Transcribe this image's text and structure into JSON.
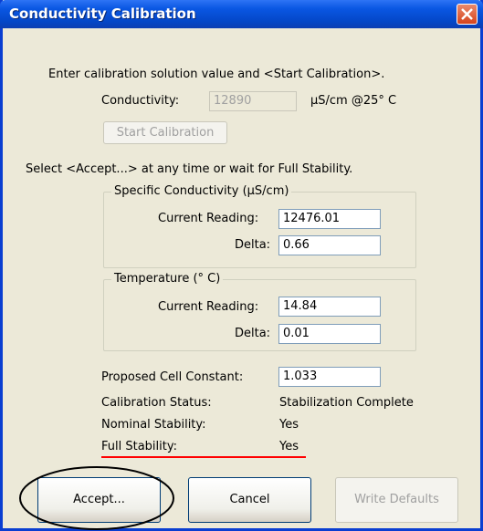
{
  "window": {
    "title": "Conductivity Calibration"
  },
  "instructions": {
    "line1": "Enter calibration solution value and <Start Calibration>.",
    "line2": "Select <Accept...> at any time or wait for Full Stability."
  },
  "conductivity": {
    "label": "Conductivity:",
    "value": "12890",
    "unit": "µS/cm @25° C"
  },
  "start_button": "Start Calibration",
  "specific_group": {
    "legend": "Specific Conductivity  (µS/cm)",
    "reading_label": "Current Reading:",
    "reading_value": "12476.01",
    "delta_label": "Delta:",
    "delta_value": "0.66"
  },
  "temp_group": {
    "legend": "Temperature (° C)",
    "reading_label": "Current Reading:",
    "reading_value": "14.84",
    "delta_label": "Delta:",
    "delta_value": "0.01"
  },
  "cell_constant": {
    "label": "Proposed Cell Constant:",
    "value": "1.033"
  },
  "status": {
    "calibration_label": "Calibration Status:",
    "calibration_value": "Stabilization Complete",
    "nominal_label": "Nominal Stability:",
    "nominal_value": "Yes",
    "full_label": "Full Stability:",
    "full_value": "Yes"
  },
  "buttons": {
    "accept": "Accept...",
    "cancel": "Cancel",
    "write_defaults": "Write Defaults"
  },
  "colors": {
    "annotation_underline": "#ff0000",
    "annotation_circle": "#000000"
  }
}
